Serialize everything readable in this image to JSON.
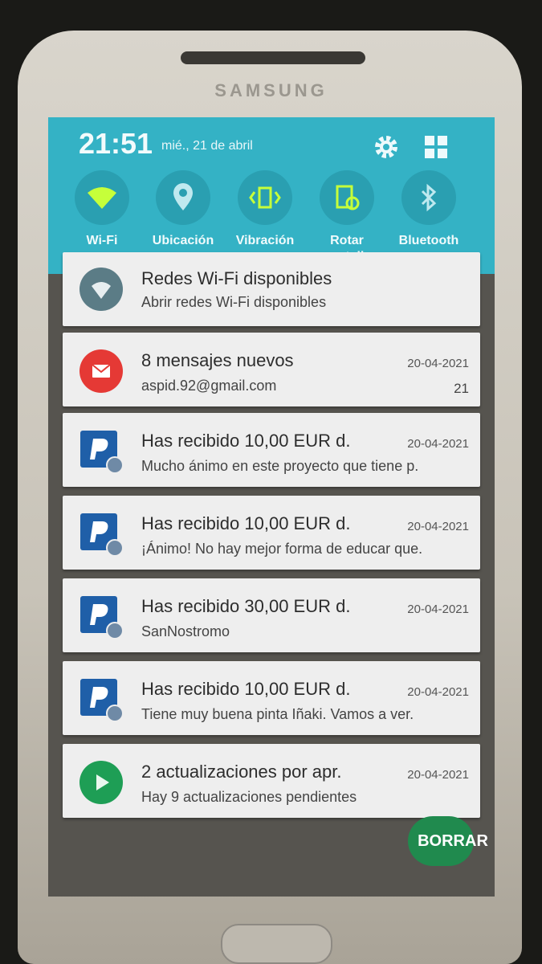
{
  "device": {
    "brand": "SAMSUNG"
  },
  "status": {
    "time": "21:51",
    "date": "mié., 21 de abril"
  },
  "quick_settings": {
    "toggles": [
      {
        "label": "Wi-Fi",
        "icon": "wifi-icon"
      },
      {
        "label": "Ubicación",
        "icon": "location-icon"
      },
      {
        "label": "Vibración",
        "icon": "vibration-icon"
      },
      {
        "label": "Rotar pantalla",
        "icon": "rotate-screen-icon"
      },
      {
        "label": "Bluetooth",
        "icon": "bluetooth-icon"
      }
    ]
  },
  "notifications": [
    {
      "title": "Redes Wi-Fi disponibles",
      "subtitle": "Abrir redes Wi-Fi disponibles",
      "time": "",
      "count": "",
      "icon": "wifi-networks-icon",
      "icon_color": "#5b7c86"
    },
    {
      "title": "8 mensajes nuevos",
      "subtitle": "aspid.92@gmail.com",
      "time": "20-04-2021",
      "count": "21",
      "icon": "mail-icon",
      "icon_color": "#e53935"
    },
    {
      "title": "Has recibido 10,00 EUR d.",
      "subtitle": "Mucho ánimo en este proyecto que tiene p.",
      "time": "20-04-2021",
      "count": "",
      "icon": "paypal-icon",
      "icon_color": "#1f5fa8"
    },
    {
      "title": "Has recibido 10,00 EUR d.",
      "subtitle": "¡Ánimo! No hay mejor forma de educar que.",
      "time": "20-04-2021",
      "count": "",
      "icon": "paypal-icon",
      "icon_color": "#1f5fa8"
    },
    {
      "title": "Has recibido 30,00 EUR d.",
      "subtitle": "SanNostromo",
      "time": "20-04-2021",
      "count": "",
      "icon": "paypal-icon",
      "icon_color": "#1f5fa8"
    },
    {
      "title": "Has recibido 10,00 EUR d.",
      "subtitle": "Tiene muy buena pinta Iñaki.  Vamos a ver.",
      "time": "20-04-2021",
      "count": "",
      "icon": "paypal-icon",
      "icon_color": "#1f5fa8"
    },
    {
      "title": "2 actualizaciones por apr.",
      "subtitle": "Hay 9 actualizaciones pendientes",
      "time": "20-04-2021",
      "count": "",
      "icon": "play-store-icon",
      "icon_color": "#1e9e55"
    }
  ],
  "actions": {
    "clear_label": "BORRAR"
  },
  "colors": {
    "panel": "#34b2c5",
    "toggle_on": "#c6ff3a",
    "toggle_off": "#bfe9ef"
  }
}
